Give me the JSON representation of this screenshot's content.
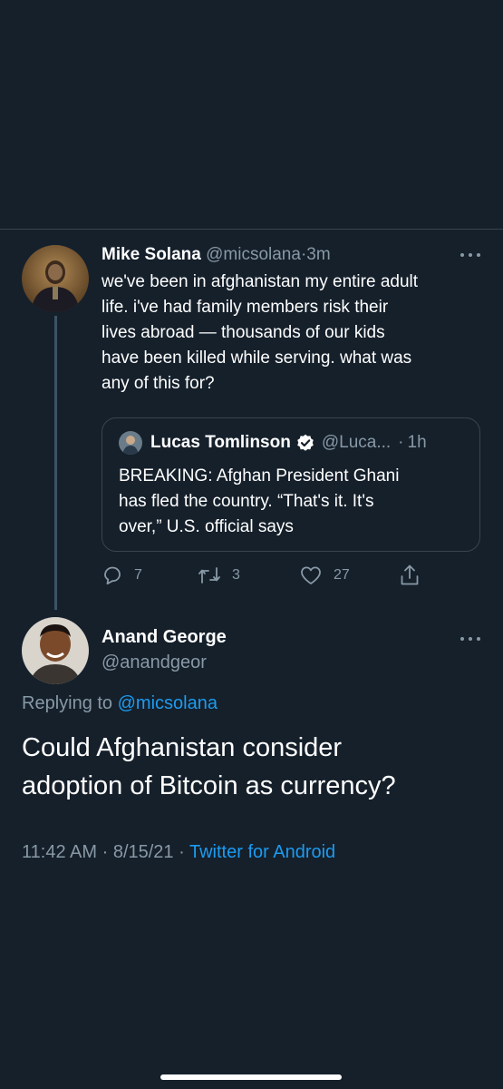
{
  "tweet1": {
    "author_name": "Mike Solana",
    "author_handle": "@micsolana",
    "separator": "·",
    "time": "3m",
    "text_lines": [
      "we've been in afghanistan my entire adult",
      "life. i've had family members risk their",
      "lives abroad — thousands of our kids",
      "have been killed while serving. what was",
      "any of this for?"
    ],
    "quoted": {
      "author_name": "Lucas Tomlinson",
      "author_handle": "@Luca...",
      "separator": "·",
      "time": "1h",
      "text_lines": [
        "BREAKING: Afghan President Ghani",
        "has fled the country. “That's it. It's",
        "over,” U.S. official says"
      ]
    },
    "actions": {
      "reply_icon": "reply-icon",
      "reply_count": "7",
      "retweet_icon": "retweet-icon",
      "retweet_count": "3",
      "like_icon": "heart-icon",
      "like_count": "27",
      "share_icon": "share-icon"
    }
  },
  "tweet2": {
    "author_name": "Anand George",
    "author_handle": "@anandgeor",
    "replying_prefix": "Replying to",
    "replying_to": "@micsolana",
    "text_lines": [
      "Could Afghanistan consider",
      "adoption of Bitcoin as currency?"
    ],
    "time": "11:42 AM",
    "separator_1": "·",
    "date": "8/15/21",
    "separator_2": "·",
    "source": "Twitter for Android"
  },
  "colors": {
    "background": "#15202b",
    "muted_text": "#8899a6",
    "link": "#1d9bf0",
    "border": "#38444d"
  }
}
